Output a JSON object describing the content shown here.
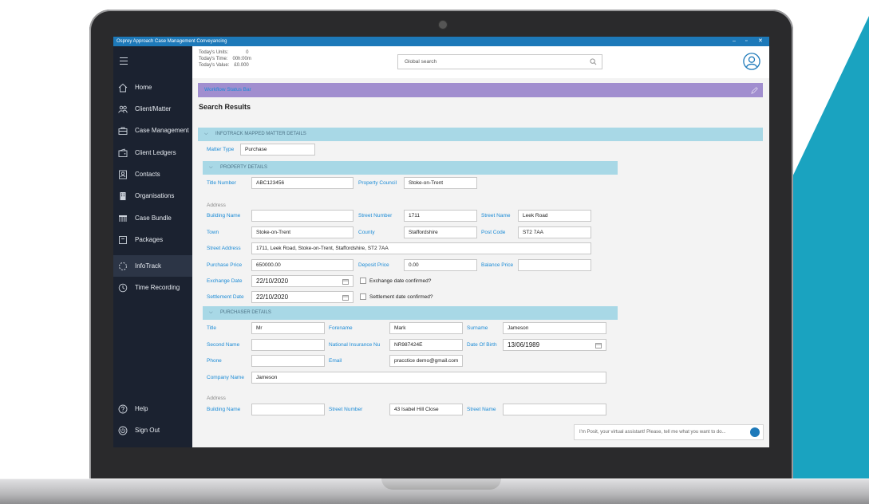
{
  "window": {
    "title": "Osprey Approach Case Management Conveyancing",
    "controls": [
      "–",
      "▫",
      "✕"
    ]
  },
  "sidebar": {
    "items": [
      {
        "label": "Home",
        "icon": "home-icon"
      },
      {
        "label": "Client/Matter",
        "icon": "users-icon"
      },
      {
        "label": "Case Management",
        "icon": "briefcase-icon"
      },
      {
        "label": "Client Ledgers",
        "icon": "wallet-icon"
      },
      {
        "label": "Contacts",
        "icon": "contact-card-icon"
      },
      {
        "label": "Organisations",
        "icon": "building-icon"
      },
      {
        "label": "Case Bundle",
        "icon": "bundle-icon"
      },
      {
        "label": "Packages",
        "icon": "package-icon"
      },
      {
        "label": "InfoTrack",
        "icon": "infotrack-icon"
      },
      {
        "label": "Time Recording",
        "icon": "clock-icon"
      }
    ],
    "bottom": [
      {
        "label": "Help",
        "icon": "help-icon"
      },
      {
        "label": "Sign Out",
        "icon": "power-icon"
      }
    ]
  },
  "stats": {
    "units_label": "Today's Units:",
    "units_value": "0",
    "time_label": "Today's Time:",
    "time_value": "00h:00m",
    "value_label": "Today's Value:",
    "value_value": "£0.000"
  },
  "search": {
    "placeholder": "Global search"
  },
  "workflow": {
    "label": "Workflow Status Bar"
  },
  "page_title": "Search Results",
  "infotrack_section": {
    "header": "INFOTRACK MAPPED MATTER DETAILS",
    "matter_type_label": "Matter Type",
    "matter_type_value": "Purchase"
  },
  "property": {
    "header": "PROPERTY DETAILS",
    "title_number_label": "Title Number",
    "title_number": "ABC123456",
    "property_council_label": "Property Council",
    "property_council": "Stoke-on-Trent",
    "address_label": "Address",
    "building_name_label": "Building Name",
    "building_name": "",
    "street_number_label": "Street Number",
    "street_number": "1711",
    "street_name_label": "Street Name",
    "street_name": "Leek Road",
    "town_label": "Town",
    "town": "Stoke-on-Trent",
    "county_label": "County",
    "county": "Staffordshire",
    "post_code_label": "Post Code",
    "post_code": "ST2 7AA",
    "street_address_label": "Street Address",
    "street_address": "1711, Leek Road, Stoke-on-Trent, Staffordshire, ST2 7AA",
    "purchase_price_label": "Purchase Price",
    "purchase_price": "650000.00",
    "deposit_price_label": "Deposit Price",
    "deposit_price": "0.00",
    "balance_price_label": "Balance Price",
    "balance_price": "",
    "exchange_date_label": "Exchange Date",
    "exchange_date": "22/10/2020",
    "exchange_confirmed_label": "Exchange date confirmed?",
    "settlement_date_label": "Settlement Date",
    "settlement_date": "22/10/2020",
    "settlement_confirmed_label": "Settlement date confirmed?"
  },
  "purchaser": {
    "header": "PURCHASER DETAILS",
    "title_label": "Title",
    "title": "Mr",
    "forename_label": "Forename",
    "forename": "Mark",
    "surname_label": "Surname",
    "surname": "Jameson",
    "second_name_label": "Second Name",
    "second_name": "",
    "ni_label": "National Insurance Nu",
    "ni": "NR987424E",
    "dob_label": "Date Of Birth",
    "dob": "13/06/1989",
    "phone_label": "Phone",
    "phone": "",
    "email_label": "Email",
    "email": "pracctice demo@gmail.com",
    "company_label": "Company Name",
    "company": "Jameson",
    "address_label": "Address",
    "building_name_label": "Building Name",
    "building_name": "",
    "street_number_label": "Street Number",
    "street_number": "43 Isabel Hill Close",
    "street_name_label": "Street Name",
    "street_name": ""
  },
  "assistant": {
    "text": "I'm Posit, your virtual assistant! Please, tell me what you want to do..."
  },
  "colors": {
    "titlebar": "#1d79b9",
    "sidebar": "#1b2230",
    "workflow": "#a18ecf",
    "section": "#a8d8e6",
    "label": "#1b8bd6",
    "teal_bg": "#1aa3c0"
  }
}
